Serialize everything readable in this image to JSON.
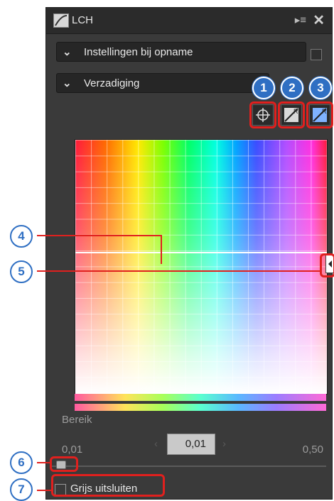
{
  "window": {
    "title": "LCH",
    "menu_icon": "panel-menu-icon",
    "close_icon": "close-icon"
  },
  "dropdowns": [
    {
      "label": "Instellingen bij opname"
    },
    {
      "label": "Verzadiging"
    }
  ],
  "toolbar": {
    "buttons": [
      {
        "icon": "crosshair-icon",
        "callout": "1"
      },
      {
        "icon": "reset-curve-icon",
        "callout": "2"
      },
      {
        "icon": "reset-all-icon",
        "callout": "3"
      }
    ]
  },
  "callouts": {
    "line": "4",
    "handle": "5",
    "slider": "6",
    "checkbox": "7"
  },
  "range": {
    "label": "Bereik",
    "min": "0,01",
    "value": "0,01",
    "max": "0,50"
  },
  "exclude_grey": {
    "label": "Grijs uitsluiten",
    "checked": false
  },
  "colors": {
    "accent_red": "#e0201e",
    "badge_blue": "#2f6fc3",
    "panel_bg": "#3a3a3a"
  }
}
